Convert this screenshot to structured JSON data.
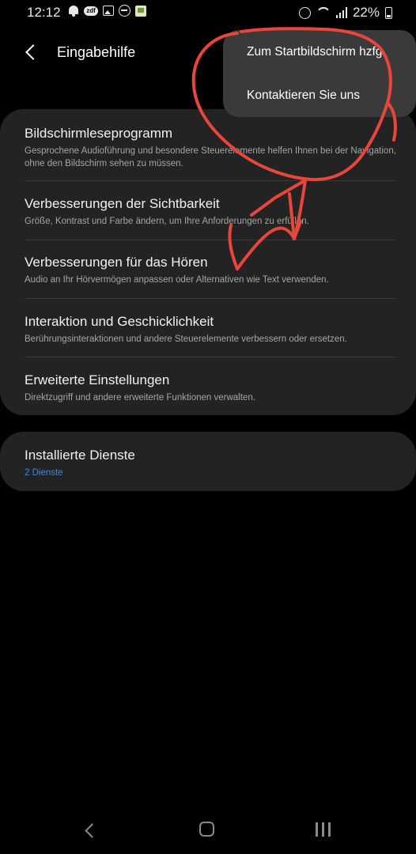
{
  "status_bar": {
    "time": "12:12",
    "battery": "22%",
    "left_icons": [
      "bell-icon",
      "zdf-icon",
      "image-icon",
      "do-not-disturb-icon",
      "app-icon"
    ],
    "right_icons": [
      "alarm-icon",
      "wifi-icon",
      "signal-icon",
      "battery-icon"
    ]
  },
  "header": {
    "title": "Eingabehilfe"
  },
  "menu": {
    "items": [
      {
        "label": "Zum Startbildschirm hzfg"
      },
      {
        "label": "Kontaktieren Sie uns"
      }
    ]
  },
  "settings": [
    {
      "title": "Bildschirmleseprogramm",
      "subtitle": "Gesprochene Audioführung und besondere Steuerelemente helfen Ihnen bei der Navigation, ohne den Bildschirm sehen zu müssen."
    },
    {
      "title": "Verbesserungen der Sichtbarkeit",
      "subtitle": "Größe, Kontrast und Farbe ändern, um Ihre Anforderungen zu erfüllen."
    },
    {
      "title": "Verbesserungen für das Hören",
      "subtitle": "Audio an Ihr Hörvermögen anpassen oder Alternativen wie Text verwenden."
    },
    {
      "title": "Interaktion und Geschicklichkeit",
      "subtitle": "Berührungsinteraktionen und andere Steuerelemente verbessern oder ersetzen."
    },
    {
      "title": "Erweiterte Einstellungen",
      "subtitle": "Direktzugriff und andere erweiterte Funktionen verwalten."
    }
  ],
  "installed": {
    "title": "Installierte Dienste",
    "subtitle": "2 Dienste"
  },
  "colors": {
    "background": "#000000",
    "card": "#232323",
    "popup": "#3a3a3a",
    "accent": "#3d8ae5",
    "annotation": "#e8453c"
  },
  "nav_bar": [
    "back-icon",
    "home-icon",
    "recents-icon"
  ]
}
